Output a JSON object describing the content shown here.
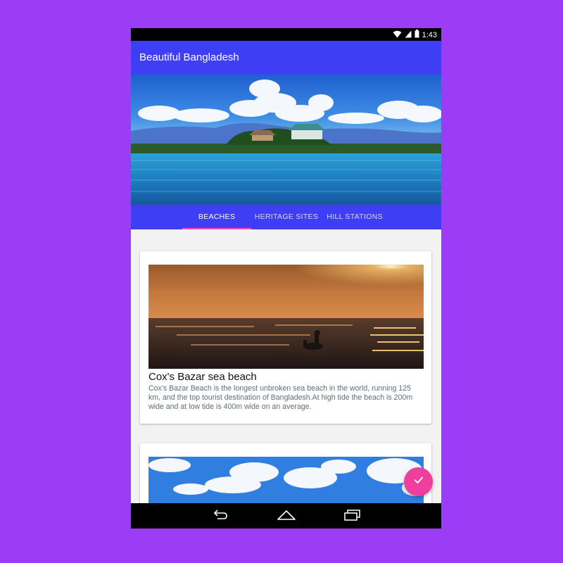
{
  "status_bar": {
    "time": "1:43",
    "icons": [
      "wifi-icon",
      "signal-icon",
      "battery-icon"
    ]
  },
  "app_bar": {
    "title": "Beautiful Bangladesh"
  },
  "hero": {
    "image": "lake-island-landscape"
  },
  "tabs": [
    {
      "label": "BEACHES",
      "active": true
    },
    {
      "label": "HERITAGE SITES",
      "active": false
    },
    {
      "label": "HILL STATIONS",
      "active": false
    }
  ],
  "cards": [
    {
      "image": "sunset-sea-beach",
      "title": "Cox's Bazar sea beach",
      "text": "Cox's Bazar Beach is the longest unbroken sea beach in the world, running 125 km, and the top tourist destination of Bangladesh.At high tide the beach is 200m wide and at low tide is 400m wide on an average."
    },
    {
      "image": "blue-sky-clouds"
    }
  ],
  "fab": {
    "icon": "check-icon"
  },
  "nav_bar": {
    "icons": [
      "back-icon",
      "home-icon",
      "recents-icon"
    ]
  },
  "colors": {
    "background": "#9b3cf7",
    "primary": "#3e3ef4",
    "accent": "#ee3f9f"
  }
}
